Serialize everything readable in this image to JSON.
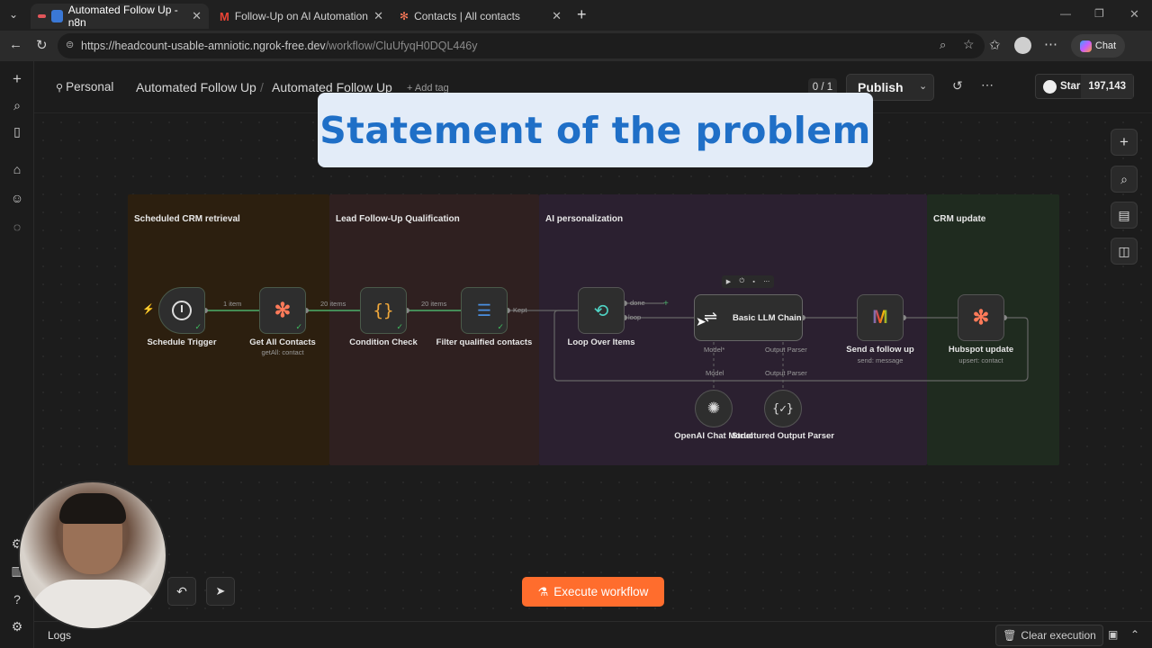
{
  "browser": {
    "tabs": [
      {
        "label": "Automated Follow Up - n8n",
        "active": true
      },
      {
        "label": "Follow-Up on AI Automation Insig",
        "active": false
      },
      {
        "label": "Contacts | All contacts",
        "active": false
      }
    ],
    "url_base": "https://headcount-usable-amniotic.ngrok-free.dev",
    "url_path": "/workflow/CluUfyqH0DQL446y",
    "chat_label": "Chat"
  },
  "header": {
    "personal": "Personal",
    "crumb1": "Automated Follow Up",
    "crumb2": "Automated Follow Up",
    "add_tag": "+ Add tag",
    "counter": "0 / 1",
    "publish": "Publish",
    "star_label": "Star",
    "star_count": "197,143"
  },
  "overlay_title": "Statement of the problem",
  "groups": [
    {
      "title": "Scheduled CRM retrieval",
      "color": "#2c1f0f"
    },
    {
      "title": "Lead Follow-Up Qualification",
      "color": "#2f2020"
    },
    {
      "title": "AI personalization",
      "color": "#2b2030"
    },
    {
      "title": "CRM update",
      "color": "#1f2b1f"
    }
  ],
  "nodes": {
    "schedule": {
      "label": "Schedule Trigger",
      "icon": "clock-icon"
    },
    "get_contacts": {
      "label": "Get All Contacts",
      "sub": "getAll: contact",
      "icon": "hubspot-icon"
    },
    "condition": {
      "label": "Condition Check",
      "icon": "braces-icon"
    },
    "filter": {
      "label": "Filter qualified contacts",
      "icon": "filter-icon"
    },
    "loop": {
      "label": "Loop Over Items",
      "icon": "loop-icon"
    },
    "llm": {
      "label": "Basic LLM Chain",
      "icon": "chain-icon"
    },
    "gmail": {
      "label": "Send a follow up",
      "sub": "send: message",
      "icon": "gmail-icon"
    },
    "hubspot": {
      "label": "Hubspot update",
      "sub": "upsert: contact",
      "icon": "hubspot-icon"
    },
    "openai": {
      "label": "OpenAI Chat Model",
      "icon": "openai-icon"
    },
    "parser": {
      "label": "Structured Output Parser",
      "icon": "braces-icon"
    }
  },
  "wire_labels": {
    "w1": "1 item",
    "w2": "20 items",
    "w3": "20 items",
    "kept": "Kept",
    "done": "done",
    "loop": "loop",
    "model_star": "Model*",
    "parser_top": "Output Parser",
    "model": "Model",
    "parser_bottom": "Output Parser"
  },
  "execute_label": "Execute workflow",
  "footer": {
    "logs": "Logs",
    "clear": "Clear execution"
  }
}
